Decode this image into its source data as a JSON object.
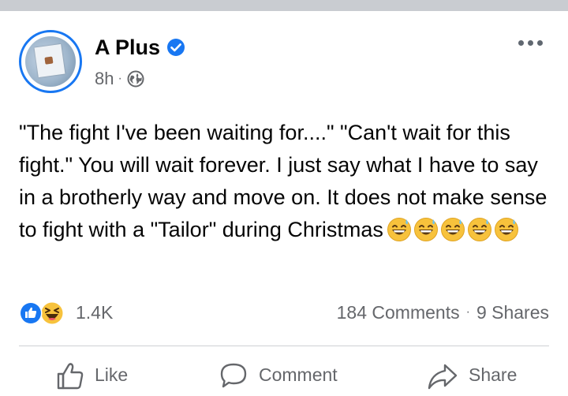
{
  "post": {
    "author": "A Plus",
    "time": "8h",
    "meta_separator": "·",
    "text": "\"The fight I've been waiting for....\" \"Can't wait for this fight.\" You will wait forever. I just say what I have to say in a brotherly way and move on. It does not make sense to fight with a \"Tailor\" during Christmas",
    "trailing_emojis": [
      "grinning-sweat",
      "grinning-sweat",
      "grinning-sweat",
      "grinning-sweat",
      "grinning-sweat"
    ]
  },
  "stats": {
    "reactions": [
      "like",
      "haha"
    ],
    "reaction_count": "1.4K",
    "comments": "184 Comments",
    "separator": "·",
    "shares": "9 Shares"
  },
  "actions": {
    "like": "Like",
    "comment": "Comment",
    "share": "Share"
  },
  "icons": {
    "verified": "verified-badge-icon",
    "privacy": "globe-icon",
    "more": "more-options-icon",
    "like": "thumbs-up-icon",
    "comment": "speech-bubble-icon",
    "share": "share-arrow-icon"
  },
  "colors": {
    "brand_blue": "#1877f2",
    "secondary_text": "#65676b",
    "divider": "#ced0d4",
    "top_bar": "#c9ccd1"
  }
}
